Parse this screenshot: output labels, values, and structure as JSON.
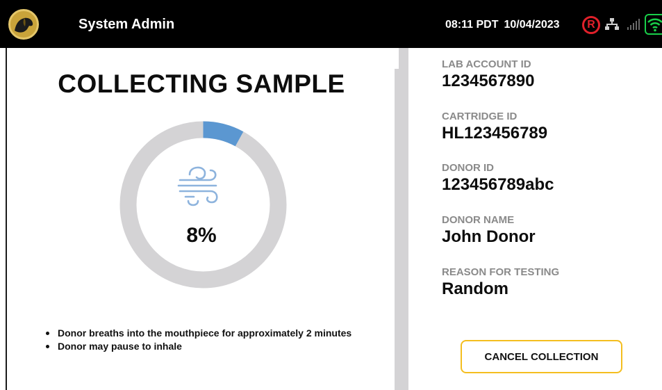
{
  "header": {
    "title": "System Admin",
    "time": "08:11 PDT",
    "date": "10/04/2023",
    "registered_mark": "R",
    "icons": [
      "dog-logo-icon",
      "network-icon",
      "signal-icon",
      "wifi-icon"
    ]
  },
  "collection": {
    "heading": "COLLECTING SAMPLE",
    "progress_percent": 8,
    "progress_text": "8%",
    "instructions": [
      "Donor breaths into the mouthpiece for approximately 2 minutes",
      "Donor may pause to inhale"
    ]
  },
  "details": [
    {
      "label": "LAB ACCOUNT ID",
      "value": "1234567890"
    },
    {
      "label": "CARTRIDGE ID",
      "value": "HL123456789"
    },
    {
      "label": "DONOR ID",
      "value": "123456789abc"
    },
    {
      "label": "DONOR NAME",
      "value": "John Donor"
    },
    {
      "label": "REASON FOR TESTING",
      "value": "Random"
    }
  ],
  "actions": {
    "cancel_label": "CANCEL COLLECTION"
  },
  "colors": {
    "header_bg": "#000000",
    "progress_fill": "#5b97d1",
    "progress_track": "#d4d3d5",
    "button_border": "#f4be1f",
    "label_gray": "#8a8a8a",
    "registered_red": "#e0202a",
    "wifi_green": "#19d04a"
  }
}
